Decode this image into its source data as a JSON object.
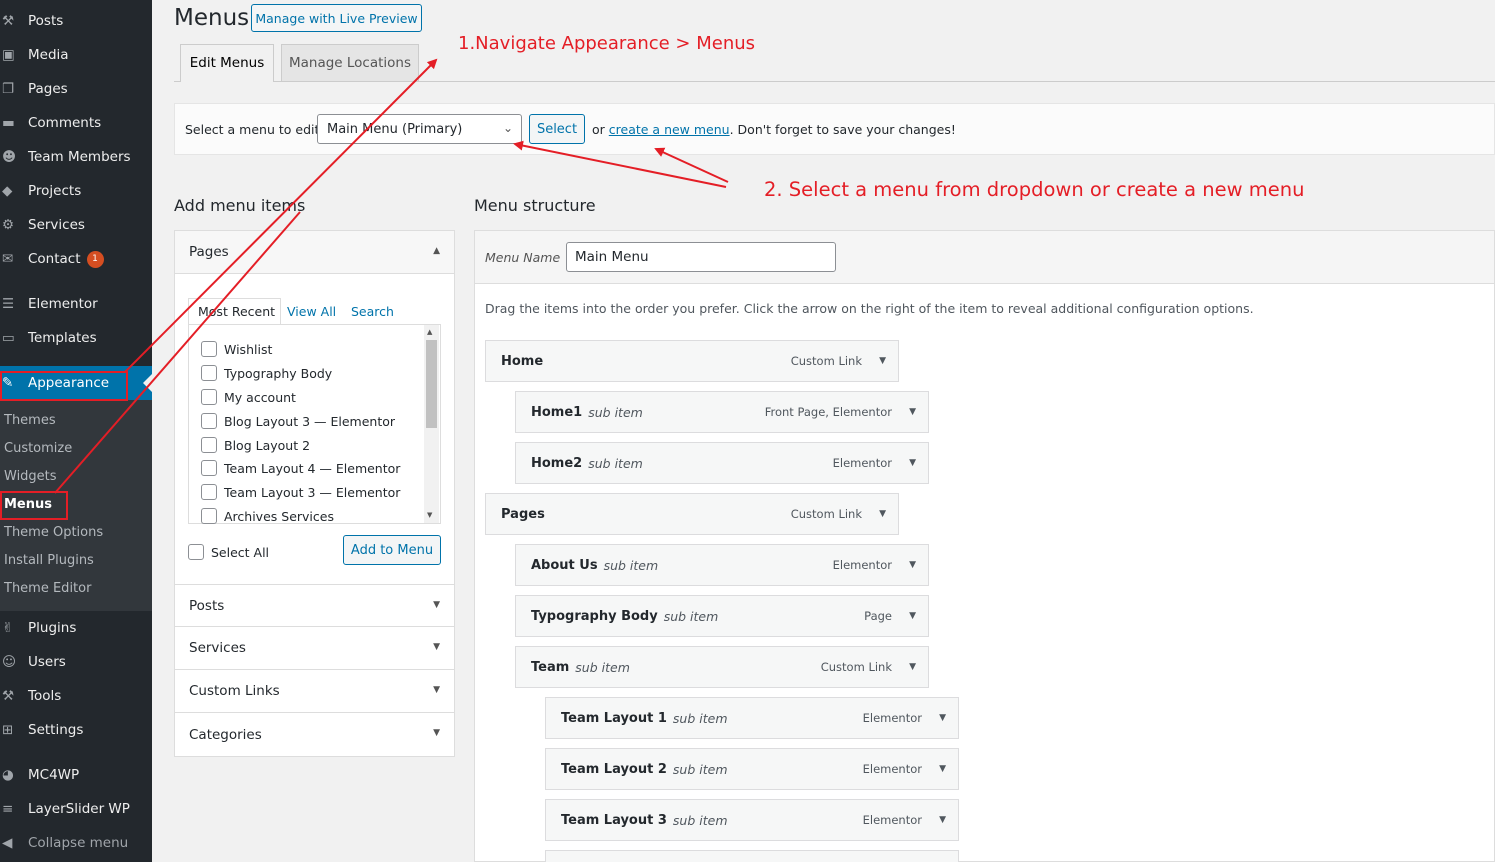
{
  "sidebar": {
    "items": [
      {
        "label": "Posts",
        "icon": "pin-icon"
      },
      {
        "label": "Media",
        "icon": "media-icon"
      },
      {
        "label": "Pages",
        "icon": "pages-icon"
      },
      {
        "label": "Comments",
        "icon": "comment-icon"
      },
      {
        "label": "Team Members",
        "icon": "users-icon"
      },
      {
        "label": "Projects",
        "icon": "tag-icon"
      },
      {
        "label": "Services",
        "icon": "services-icon"
      },
      {
        "label": "Contact",
        "icon": "mail-icon",
        "badge": "1"
      },
      {
        "label": "Elementor",
        "icon": "elementor-icon"
      },
      {
        "label": "Templates",
        "icon": "folder-icon"
      },
      {
        "label": "Appearance",
        "icon": "brush-icon"
      },
      {
        "label": "Plugins",
        "icon": "plugin-icon"
      },
      {
        "label": "Users",
        "icon": "user-icon"
      },
      {
        "label": "Tools",
        "icon": "wrench-icon"
      },
      {
        "label": "Settings",
        "icon": "settings-icon"
      },
      {
        "label": "MC4WP",
        "icon": "mc4wp-icon"
      },
      {
        "label": "LayerSlider WP",
        "icon": "layers-icon"
      },
      {
        "label": "Collapse menu",
        "icon": "collapse-icon"
      }
    ],
    "submenu": [
      "Themes",
      "Customize",
      "Widgets",
      "Menus",
      "Theme Options",
      "Install Plugins",
      "Theme Editor"
    ]
  },
  "header": {
    "title": "Menus",
    "live_preview": "Manage with Live Preview",
    "tabs": [
      "Edit Menus",
      "Manage Locations"
    ]
  },
  "select_bar": {
    "label": "Select a menu to edit:",
    "selected": "Main Menu (Primary)",
    "select_button": "Select",
    "or": "or",
    "create_link": "create a new menu",
    "suffix": ". Don't forget to save your changes!"
  },
  "annotations": {
    "step1": "1.Navigate Appearance > Menus",
    "step2": "2. Select a menu from dropdown or create a new menu",
    "color": "#e41e26"
  },
  "add_items": {
    "heading": "Add menu items",
    "pages_title": "Pages",
    "tabs": [
      "Most Recent",
      "View All",
      "Search"
    ],
    "pages": [
      "Wishlist",
      "Typography Body",
      "My account",
      "Blog Layout 3 — Elementor",
      "Blog Layout 2",
      "Team Layout 4 — Elementor",
      "Team Layout 3 — Elementor",
      "Archives Services"
    ],
    "select_all": "Select All",
    "add_button": "Add to Menu",
    "sections": [
      "Posts",
      "Services",
      "Custom Links",
      "Categories"
    ]
  },
  "structure": {
    "heading": "Menu structure",
    "name_label": "Menu Name",
    "name_value": "Main Menu",
    "instructions": "Drag the items into the order you prefer. Click the arrow on the right of the item to reveal additional configuration options.",
    "items": [
      {
        "title": "Home",
        "sub": "",
        "type": "Custom Link",
        "depth": 0
      },
      {
        "title": "Home1",
        "sub": "sub item",
        "type": "Front Page, Elementor",
        "depth": 1
      },
      {
        "title": "Home2",
        "sub": "sub item",
        "type": "Elementor",
        "depth": 1
      },
      {
        "title": "Pages",
        "sub": "",
        "type": "Custom Link",
        "depth": 0
      },
      {
        "title": "About Us",
        "sub": "sub item",
        "type": "Elementor",
        "depth": 1
      },
      {
        "title": "Typography Body",
        "sub": "sub item",
        "type": "Page",
        "depth": 1
      },
      {
        "title": "Team",
        "sub": "sub item",
        "type": "Custom Link",
        "depth": 1
      },
      {
        "title": "Team Layout 1",
        "sub": "sub item",
        "type": "Elementor",
        "depth": 2
      },
      {
        "title": "Team Layout 2",
        "sub": "sub item",
        "type": "Elementor",
        "depth": 2
      },
      {
        "title": "Team Layout 3",
        "sub": "sub item",
        "type": "Elementor",
        "depth": 2
      }
    ]
  },
  "colors": {
    "sidebar": "#23282d",
    "accent": "#0073aa",
    "annotation": "#e41e26"
  }
}
